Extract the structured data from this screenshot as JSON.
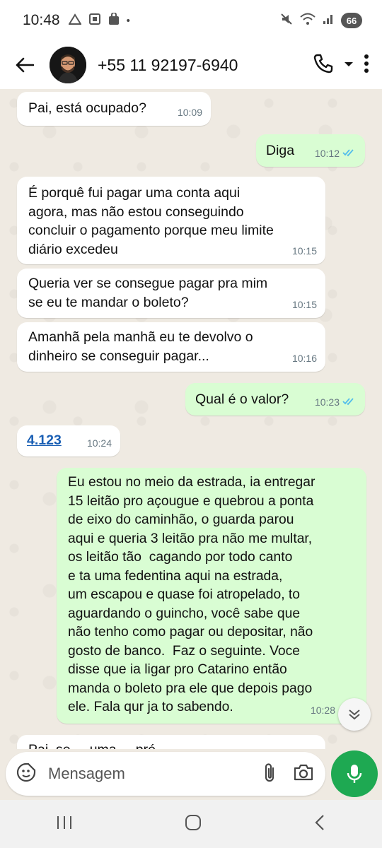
{
  "status_bar": {
    "time": "10:48",
    "battery": "66"
  },
  "header": {
    "contact_name": "+55 11 92197-6940"
  },
  "messages": [
    {
      "dir": "in",
      "text": "Pai, está ocupado?",
      "time": "10:09"
    },
    {
      "dir": "out",
      "text": "Diga",
      "time": "10:12"
    },
    {
      "dir": "in",
      "text": "É porquê fui pagar uma conta aqui\nagora, mas não estou conseguindo\nconcluir o pagamento porque meu limite\ndiário excedeu",
      "time": "10:15"
    },
    {
      "dir": "in",
      "text": "Queria ver se consegue pagar pra mim\nse eu te mandar o boleto?",
      "time": "10:15"
    },
    {
      "dir": "in",
      "text": "Amanhã pela manhã eu te devolvo o\ndinheiro se conseguir pagar...",
      "time": "10:16"
    },
    {
      "dir": "out",
      "text": "Qual é o valor?",
      "time": "10:23"
    },
    {
      "dir": "in",
      "text": "4.123",
      "time": "10:24"
    },
    {
      "dir": "out",
      "text": "Eu estou no meio da estrada, ia entregar\n15 leitão pro açougue e quebrou a ponta\nde eixo do caminhão, o guarda parou\naqui e queria 3 leitão pra não me multar,\nos leitão tão  cagando por todo canto\ne ta uma fedentina aqui na estrada,\num escapou e quase foi atropelado, to\naguardando o guincho, você sabe que\nnão tenho como pagar ou depositar, não\ngosto de banco.  Faz o seguinte. Voce\ndisse que ia ligar pro Catarino então\nmanda o boleto pra ele que depois pago\nele. Fala qur ja to sabendo.",
      "time": "10:28"
    },
    {
      "dir": "in",
      "text": "Pai, se ... uma ... pré ...",
      "time": ""
    }
  ],
  "input": {
    "placeholder": "Mensagem"
  },
  "colors": {
    "outgoing_bubble": "#d9fdd3",
    "incoming_bubble": "#ffffff",
    "chat_bg": "#efeae2",
    "mic_button": "#1ea952",
    "read_ticks": "#53bdeb"
  }
}
